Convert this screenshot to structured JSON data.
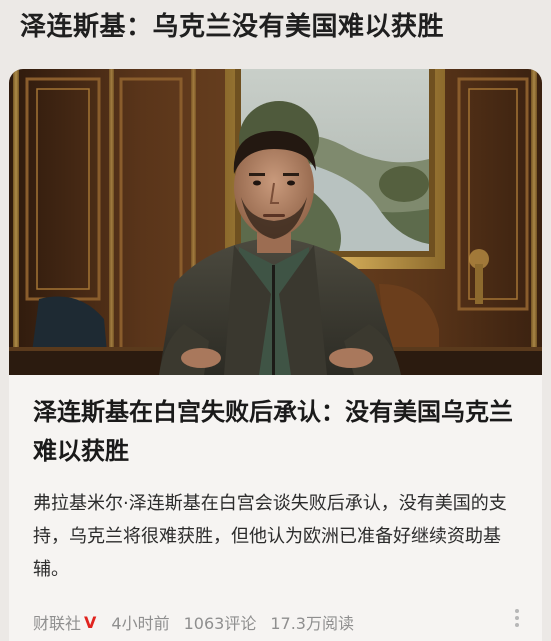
{
  "page": {
    "title": "泽连斯基：乌克兰没有美国难以获胜"
  },
  "article": {
    "headline": "泽连斯基在白宫失败后承认：没有美国乌克兰难以获胜",
    "summary": "弗拉基米尔·泽连斯基在白宫会谈失败后承认，没有美国的支持，乌克兰将很难获胜，但他认为欧洲已准备好继续资助基辅。",
    "source": "财联社",
    "verified_mark": "V",
    "time": "4小时前",
    "comments": "1063评论",
    "reads": "17.3万阅读",
    "image_icon": "photo-icon"
  },
  "colors": {
    "background": "#ece9e6",
    "card": "#f6f4f2",
    "verified_red": "#e0241f",
    "meta_gray": "#8f8f8f"
  }
}
